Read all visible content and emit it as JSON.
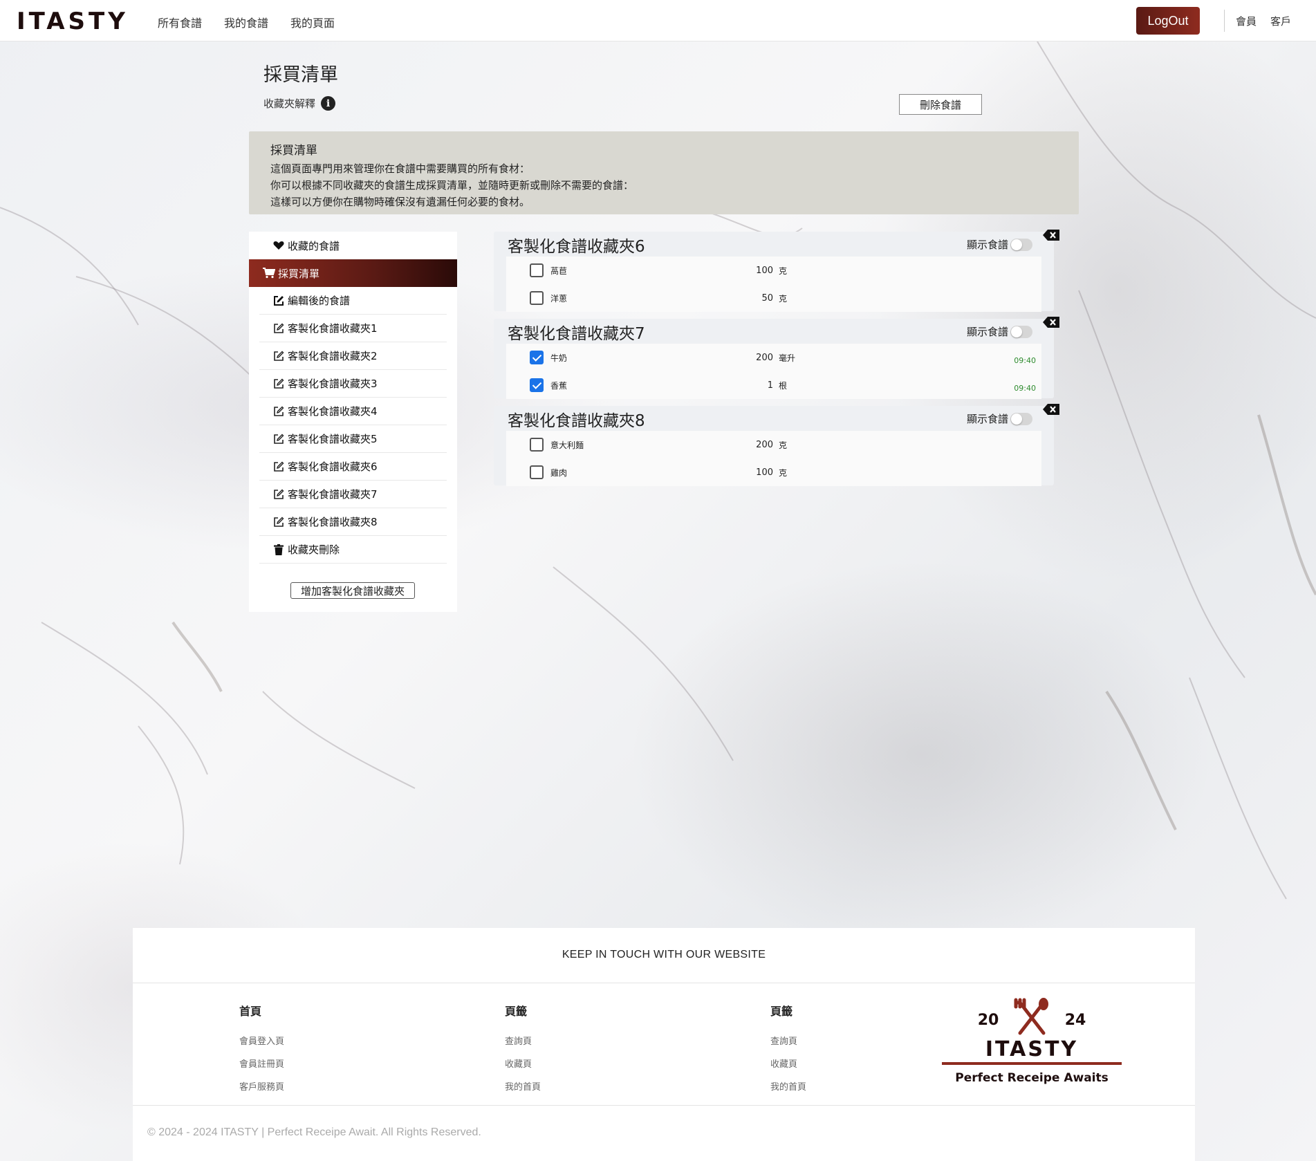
{
  "header": {
    "logo": "ITASTY",
    "nav": [
      "所有食譜",
      "我的食譜",
      "我的頁面"
    ],
    "logout": "LogOut",
    "right_links": [
      "會員",
      "客戶"
    ],
    "accent_color": "#7a2418"
  },
  "page": {
    "title": "採買清單",
    "explain_label": "收藏夾解釋",
    "delete_button": "刪除食譜"
  },
  "notice": {
    "title": "採買清單",
    "lines": [
      "這個頁面專門用來管理你在食譜中需要購買的所有食材：",
      "你可以根據不同收藏夾的食譜生成採買清單，並隨時更新或刪除不需要的食譜：",
      "這樣可以方便你在購物時確保沒有遺漏任何必要的食材。"
    ]
  },
  "sidebar": {
    "favorites": "收藏的食譜",
    "shopping": "採買清單",
    "edited": "編輯後的食譜",
    "folders": [
      "客製化食譜收藏夾1",
      "客製化食譜收藏夾2",
      "客製化食譜收藏夾3",
      "客製化食譜收藏夾4",
      "客製化食譜收藏夾5",
      "客製化食譜收藏夾6",
      "客製化食譜收藏夾7",
      "客製化食譜收藏夾8"
    ],
    "delete_folder": "收藏夾刪除",
    "add_folder": "增加客製化食譜收藏夾"
  },
  "cards": [
    {
      "title": "客製化食譜收藏夾6",
      "show_label": "顯示食譜",
      "items": [
        {
          "name": "萵苣",
          "qty": "100",
          "unit": "克",
          "checked": false,
          "time": ""
        },
        {
          "name": "洋蔥",
          "qty": "50",
          "unit": "克",
          "checked": false,
          "time": ""
        }
      ]
    },
    {
      "title": "客製化食譜收藏夾7",
      "show_label": "顯示食譜",
      "items": [
        {
          "name": "牛奶",
          "qty": "200",
          "unit": "毫升",
          "checked": true,
          "time": "09:40"
        },
        {
          "name": "香蕉",
          "qty": "1",
          "unit": "根",
          "checked": true,
          "time": "09:40"
        }
      ]
    },
    {
      "title": "客製化食譜收藏夾8",
      "show_label": "顯示食譜",
      "items": [
        {
          "name": "意大利麵",
          "qty": "200",
          "unit": "克",
          "checked": false,
          "time": ""
        },
        {
          "name": "雞肉",
          "qty": "100",
          "unit": "克",
          "checked": false,
          "time": ""
        }
      ]
    }
  ],
  "footer": {
    "headline": "KEEP IN TOUCH WITH OUR WEBSITE",
    "columns": [
      {
        "title": "首頁",
        "links": [
          "會員登入頁",
          "會員註冊頁",
          "客戶服務頁"
        ]
      },
      {
        "title": "頁籤",
        "links": [
          "查詢頁",
          "收藏頁",
          "我的首頁"
        ]
      },
      {
        "title": "頁籤",
        "links": [
          "查詢頁",
          "收藏頁",
          "我的首頁"
        ]
      }
    ],
    "logo_year_left": "20",
    "logo_year_right": "24",
    "logo_name": "ITASTY",
    "logo_tagline": "Perfect Receipe Awaits",
    "copyright": "© 2024 - 2024 ITASTY | Perfect Receipe Await. All Rights Reserved."
  }
}
